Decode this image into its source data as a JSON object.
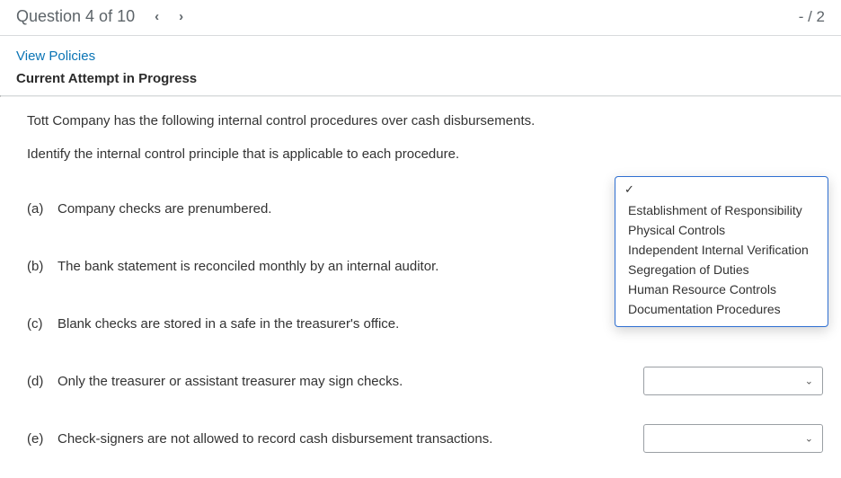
{
  "header": {
    "title": "Question 4 of 10",
    "prev_glyph": "‹",
    "next_glyph": "›",
    "score_prefix": "- / ",
    "score_total": "2"
  },
  "links": {
    "policies": "View Policies"
  },
  "attempt_label": "Current Attempt in Progress",
  "prompt": {
    "line1": "Tott Company has the following internal control procedures over cash disbursements.",
    "line2": "Identify the internal control principle that is applicable to each procedure."
  },
  "items": [
    {
      "label": "(a)",
      "text": "Company checks are prenumbered."
    },
    {
      "label": "(b)",
      "text": "The bank statement is reconciled monthly by an internal auditor."
    },
    {
      "label": "(c)",
      "text": "Blank checks are stored in a safe in the treasurer's office."
    },
    {
      "label": "(d)",
      "text": "Only the treasurer or assistant treasurer may sign checks."
    },
    {
      "label": "(e)",
      "text": "Check-signers are not allowed to record cash disbursement transactions."
    }
  ],
  "dropdown": {
    "checkmark": "✓",
    "options": [
      "Establishment of Responsibility",
      "Physical Controls",
      "Independent Internal Verification",
      "Segregation of Duties",
      "Human Resource Controls",
      "Documentation Procedures"
    ]
  },
  "glyphs": {
    "chevron_down": "⌄"
  }
}
